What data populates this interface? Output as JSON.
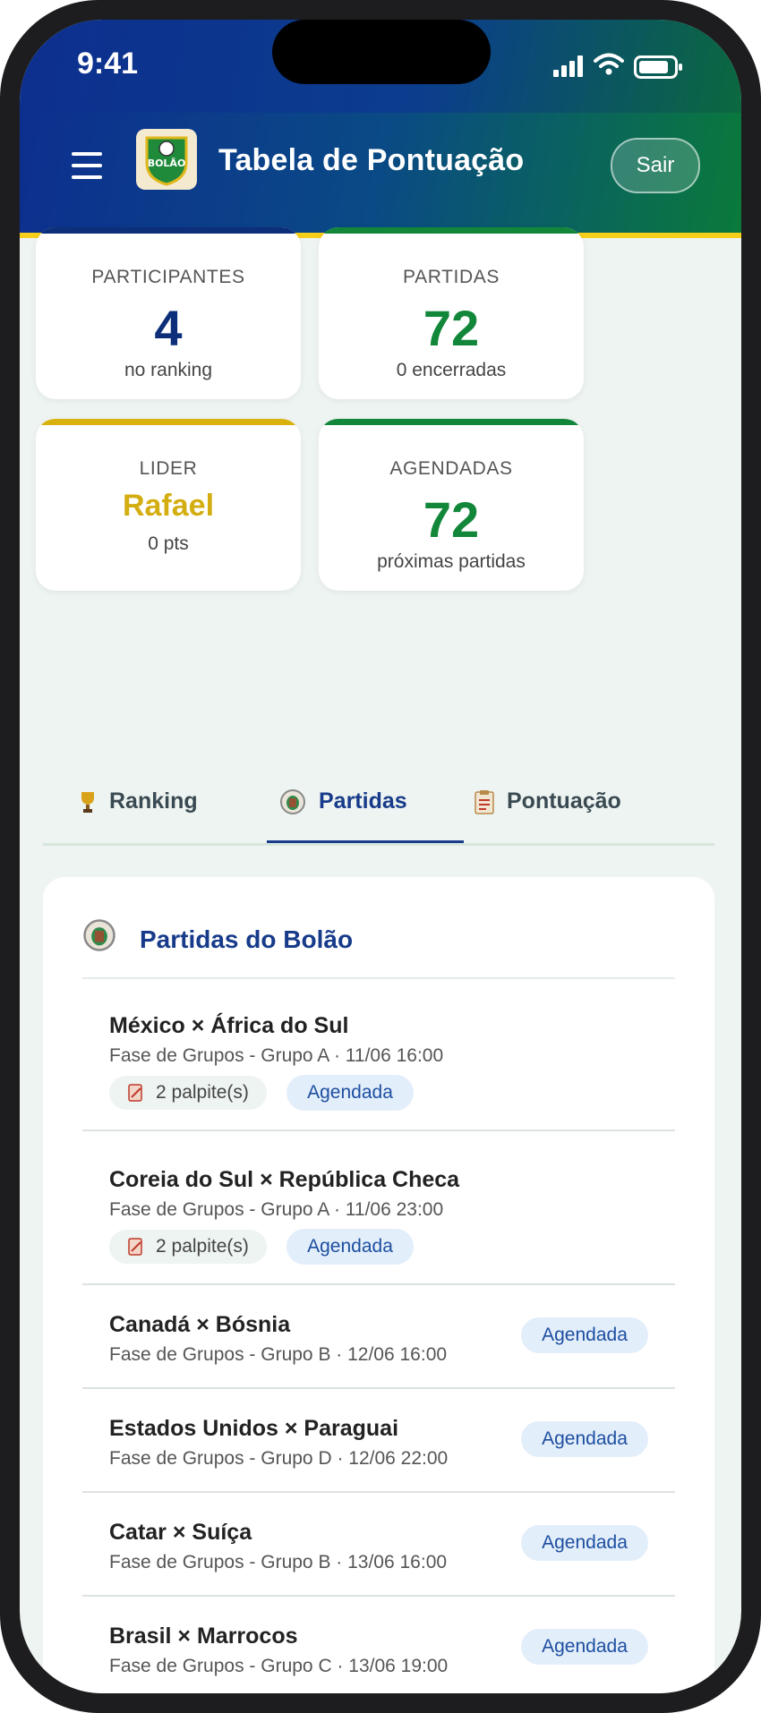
{
  "status_bar": {
    "time": "9:41"
  },
  "header": {
    "title": "Tabela de Pontuação",
    "logout_label": "Sair",
    "logo_text": "BOLÃO"
  },
  "stats": [
    {
      "label": "PARTICIPANTES",
      "value": "4",
      "sub": "no ranking",
      "accent": "#0d2f7a"
    },
    {
      "label": "PARTIDAS",
      "value": "72",
      "sub": "0 encerradas",
      "accent": "#12873a"
    },
    {
      "label": "LIDER",
      "value": "Rafael",
      "sub": "0 pts",
      "accent": "#d9b10c"
    },
    {
      "label": "AGENDADAS",
      "value": "72",
      "sub": "próximas partidas",
      "accent": "#12873a"
    }
  ],
  "tabs": [
    {
      "label": "Ranking",
      "icon": "trophy-icon"
    },
    {
      "label": "Partidas",
      "icon": "stadium-icon",
      "active": true
    },
    {
      "label": "Pontuação",
      "icon": "clipboard-icon"
    }
  ],
  "matches_panel": {
    "title": "Partidas do Bolão",
    "matches": [
      {
        "teams": "México × África do Sul",
        "meta": "Fase de Grupos - Grupo A · 11/06 16:00",
        "guesses": "2 palpite(s)",
        "status": "Agendada"
      },
      {
        "teams": "Coreia do Sul × República Checa",
        "meta": "Fase de Grupos - Grupo A · 11/06 23:00",
        "guesses": "2 palpite(s)",
        "status": "Agendada"
      },
      {
        "teams": "Canadá × Bósnia",
        "meta": "Fase de Grupos - Grupo B · 12/06 16:00",
        "status": "Agendada"
      },
      {
        "teams": "Estados Unidos × Paraguai",
        "meta": "Fase de Grupos - Grupo D · 12/06 22:00",
        "status": "Agendada"
      },
      {
        "teams": "Catar × Suíça",
        "meta": "Fase de Grupos - Grupo B · 13/06 16:00",
        "status": "Agendada"
      },
      {
        "teams": "Brasil × Marrocos",
        "meta": "Fase de Grupos - Grupo C · 13/06 19:00",
        "status": "Agendada"
      }
    ]
  },
  "colors": {
    "brand_blue": "#0d2f8f",
    "brand_green": "#0b6b3a",
    "accent_yellow": "#f6cf1b"
  }
}
